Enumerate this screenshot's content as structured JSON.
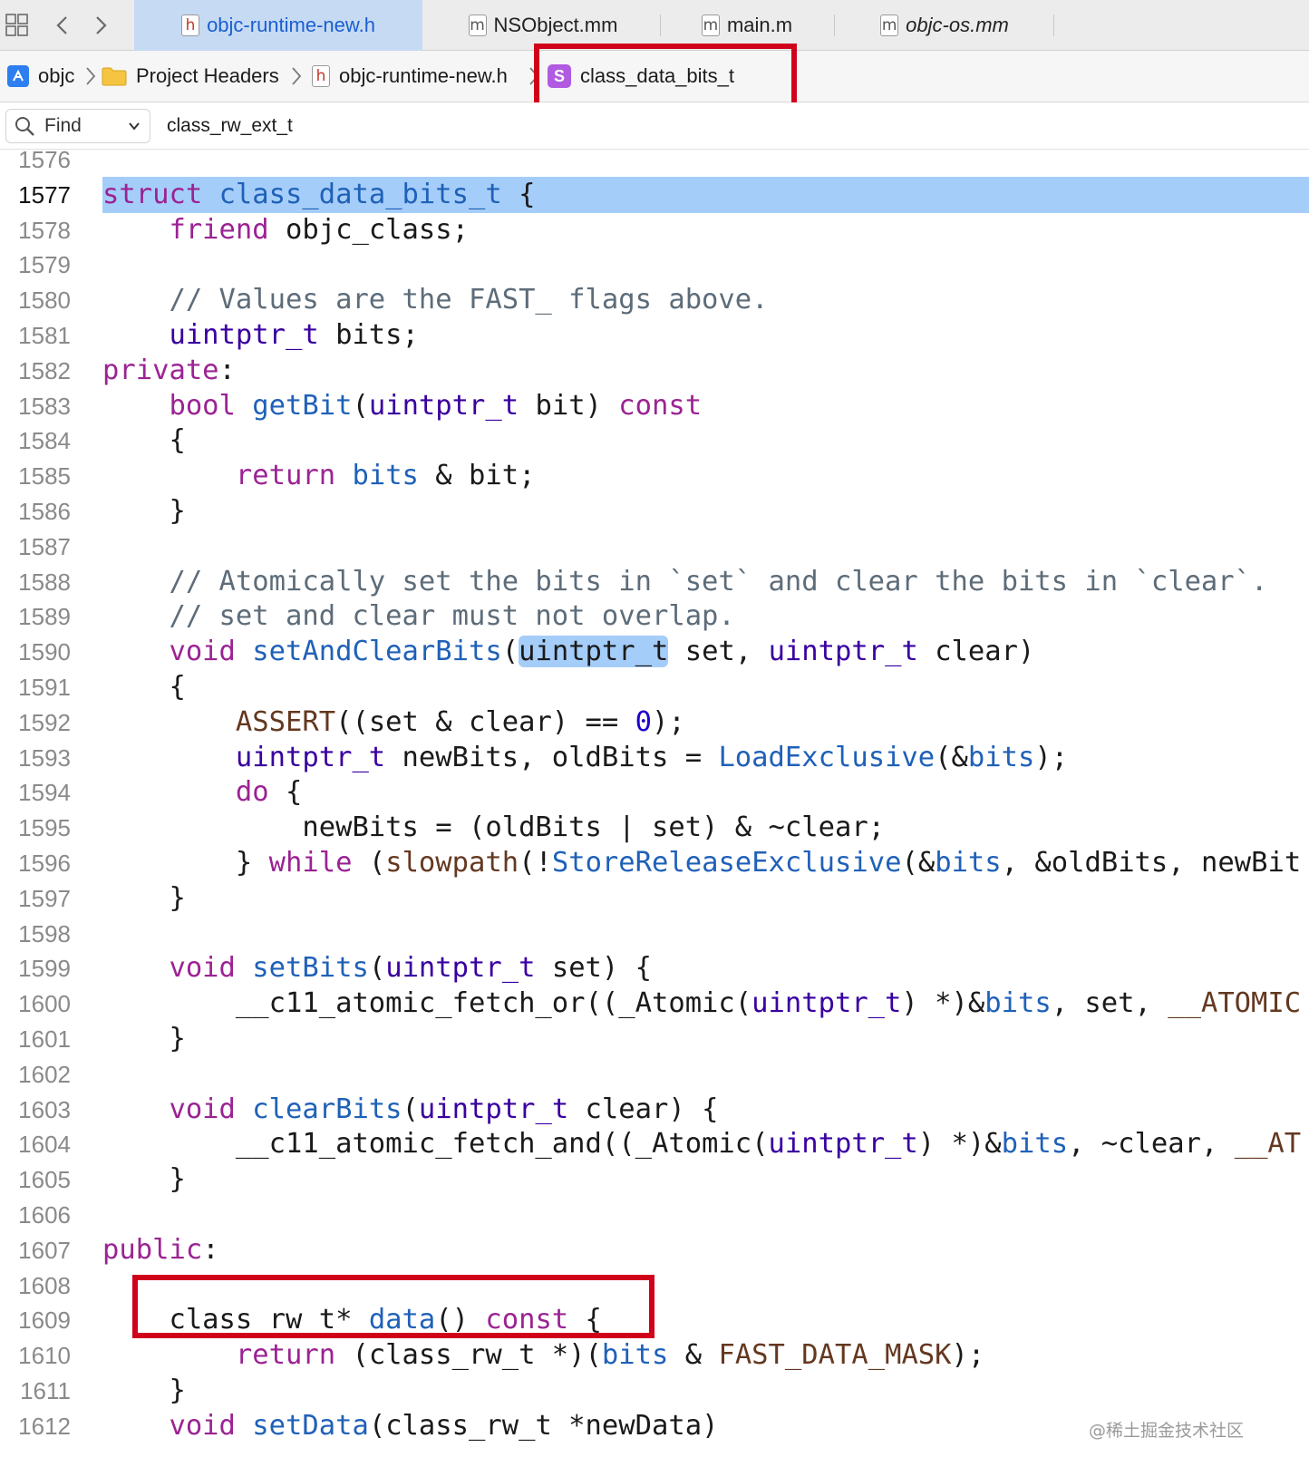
{
  "colors": {
    "active_tab_bg": "#c6daf3",
    "selection": "#a5cdf9",
    "annotation_box": "#d0021b",
    "keyword": "#9b2393",
    "type": "#3900a0",
    "function": "#1f61b8",
    "comment": "#5d6c79",
    "macro": "#643820"
  },
  "toolbar": {
    "grid_icon": "grid-icon",
    "back_icon": "chevron-left-icon",
    "forward_icon": "chevron-right-icon"
  },
  "tabs": [
    {
      "label": "objc-runtime-new.h",
      "icon": "h",
      "active": true
    },
    {
      "label": "NSObject.mm",
      "icon": "m",
      "active": false
    },
    {
      "label": "main.m",
      "icon": "m",
      "active": false
    },
    {
      "label": "objc-os.mm",
      "icon": "m",
      "active": false
    }
  ],
  "jumpbar": [
    {
      "label": "objc",
      "icon": "project-icon"
    },
    {
      "label": "Project Headers",
      "icon": "folder-icon"
    },
    {
      "label": "objc-runtime-new.h",
      "icon": "h"
    },
    {
      "label": "class_data_bits_t",
      "icon": "S"
    }
  ],
  "find": {
    "mode_label": "Find",
    "query": "class_rw_ext_t"
  },
  "editor": {
    "current_line": "1577",
    "lines": [
      {
        "n": "1576",
        "tokens": []
      },
      {
        "n": "1577",
        "tokens": [
          [
            "kw",
            "struct"
          ],
          [
            "t",
            " "
          ],
          [
            "fn",
            "class_data_bits_t"
          ],
          [
            "t",
            " {"
          ]
        ]
      },
      {
        "n": "1578",
        "tokens": [
          [
            "t",
            "    "
          ],
          [
            "kw",
            "friend"
          ],
          [
            "t",
            " objc_class;"
          ]
        ]
      },
      {
        "n": "1579",
        "tokens": []
      },
      {
        "n": "1580",
        "tokens": [
          [
            "t",
            "    "
          ],
          [
            "cm",
            "// Values are the FAST_ flags above."
          ]
        ]
      },
      {
        "n": "1581",
        "tokens": [
          [
            "t",
            "    "
          ],
          [
            "ty",
            "uintptr_t"
          ],
          [
            "t",
            " bits;"
          ]
        ]
      },
      {
        "n": "1582",
        "tokens": [
          [
            "kw",
            "private"
          ],
          [
            "t",
            ":"
          ]
        ]
      },
      {
        "n": "1583",
        "tokens": [
          [
            "t",
            "    "
          ],
          [
            "kw",
            "bool"
          ],
          [
            "t",
            " "
          ],
          [
            "fn",
            "getBit"
          ],
          [
            "t",
            "("
          ],
          [
            "ty",
            "uintptr_t"
          ],
          [
            "t",
            " bit) "
          ],
          [
            "kw",
            "const"
          ]
        ]
      },
      {
        "n": "1584",
        "tokens": [
          [
            "t",
            "    {"
          ]
        ]
      },
      {
        "n": "1585",
        "tokens": [
          [
            "t",
            "        "
          ],
          [
            "kw",
            "return"
          ],
          [
            "t",
            " "
          ],
          [
            "mv",
            "bits"
          ],
          [
            "t",
            " & bit;"
          ]
        ]
      },
      {
        "n": "1586",
        "tokens": [
          [
            "t",
            "    }"
          ]
        ]
      },
      {
        "n": "1587",
        "tokens": []
      },
      {
        "n": "1588",
        "tokens": [
          [
            "t",
            "    "
          ],
          [
            "cm",
            "// Atomically set the bits in `set` and clear the bits in `clear`."
          ]
        ]
      },
      {
        "n": "1589",
        "tokens": [
          [
            "t",
            "    "
          ],
          [
            "cm",
            "// set and clear must not overlap."
          ]
        ]
      },
      {
        "n": "1590",
        "tokens": [
          [
            "t",
            "    "
          ],
          [
            "kw",
            "void"
          ],
          [
            "t",
            " "
          ],
          [
            "fn",
            "setAndClearBits"
          ],
          [
            "t",
            "("
          ],
          [
            "hl",
            "uintptr_t"
          ],
          [
            "t",
            " set, "
          ],
          [
            "ty",
            "uintptr_t"
          ],
          [
            "t",
            " clear)"
          ]
        ]
      },
      {
        "n": "1591",
        "tokens": [
          [
            "t",
            "    {"
          ]
        ]
      },
      {
        "n": "1592",
        "tokens": [
          [
            "t",
            "        "
          ],
          [
            "mac",
            "ASSERT"
          ],
          [
            "t",
            "((set & clear) == "
          ],
          [
            "num",
            "0"
          ],
          [
            "t",
            ");"
          ]
        ]
      },
      {
        "n": "1593",
        "tokens": [
          [
            "t",
            "        "
          ],
          [
            "ty",
            "uintptr_t"
          ],
          [
            "t",
            " newBits, oldBits = "
          ],
          [
            "fn",
            "LoadExclusive"
          ],
          [
            "t",
            "(&"
          ],
          [
            "mv",
            "bits"
          ],
          [
            "t",
            ");"
          ]
        ]
      },
      {
        "n": "1594",
        "tokens": [
          [
            "t",
            "        "
          ],
          [
            "kw",
            "do"
          ],
          [
            "t",
            " {"
          ]
        ]
      },
      {
        "n": "1595",
        "tokens": [
          [
            "t",
            "            newBits = (oldBits | set) & ~clear;"
          ]
        ]
      },
      {
        "n": "1596",
        "tokens": [
          [
            "t",
            "        } "
          ],
          [
            "kw",
            "while"
          ],
          [
            "t",
            " ("
          ],
          [
            "mac",
            "slowpath"
          ],
          [
            "t",
            "(!"
          ],
          [
            "fn",
            "StoreReleaseExclusive"
          ],
          [
            "t",
            "(&"
          ],
          [
            "mv",
            "bits"
          ],
          [
            "t",
            ", &oldBits, newBit"
          ]
        ]
      },
      {
        "n": "1597",
        "tokens": [
          [
            "t",
            "    }"
          ]
        ]
      },
      {
        "n": "1598",
        "tokens": []
      },
      {
        "n": "1599",
        "tokens": [
          [
            "t",
            "    "
          ],
          [
            "kw",
            "void"
          ],
          [
            "t",
            " "
          ],
          [
            "fn",
            "setBits"
          ],
          [
            "t",
            "("
          ],
          [
            "ty",
            "uintptr_t"
          ],
          [
            "t",
            " set) {"
          ]
        ]
      },
      {
        "n": "1600",
        "tokens": [
          [
            "t",
            "        __c11_atomic_fetch_or((_Atomic("
          ],
          [
            "ty",
            "uintptr_t"
          ],
          [
            "t",
            ") *)&"
          ],
          [
            "mv",
            "bits"
          ],
          [
            "t",
            ", set, "
          ],
          [
            "mac",
            "__ATOMIC"
          ]
        ]
      },
      {
        "n": "1601",
        "tokens": [
          [
            "t",
            "    }"
          ]
        ]
      },
      {
        "n": "1602",
        "tokens": []
      },
      {
        "n": "1603",
        "tokens": [
          [
            "t",
            "    "
          ],
          [
            "kw",
            "void"
          ],
          [
            "t",
            " "
          ],
          [
            "fn",
            "clearBits"
          ],
          [
            "t",
            "("
          ],
          [
            "ty",
            "uintptr_t"
          ],
          [
            "t",
            " clear) {"
          ]
        ]
      },
      {
        "n": "1604",
        "tokens": [
          [
            "t",
            "        __c11_atomic_fetch_and((_Atomic("
          ],
          [
            "ty",
            "uintptr_t"
          ],
          [
            "t",
            ") *)&"
          ],
          [
            "mv",
            "bits"
          ],
          [
            "t",
            ", ~clear, "
          ],
          [
            "mac",
            "__AT"
          ]
        ]
      },
      {
        "n": "1605",
        "tokens": [
          [
            "t",
            "    }"
          ]
        ]
      },
      {
        "n": "1606",
        "tokens": []
      },
      {
        "n": "1607",
        "tokens": [
          [
            "kw",
            "public"
          ],
          [
            "t",
            ":"
          ]
        ]
      },
      {
        "n": "1608",
        "tokens": []
      },
      {
        "n": "1609",
        "tokens": [
          [
            "t",
            "    class_rw_t* "
          ],
          [
            "fn",
            "data"
          ],
          [
            "t",
            "() "
          ],
          [
            "kw",
            "const"
          ],
          [
            "t",
            " {"
          ]
        ]
      },
      {
        "n": "1610",
        "tokens": [
          [
            "t",
            "        "
          ],
          [
            "kw",
            "return"
          ],
          [
            "t",
            " (class_rw_t *)("
          ],
          [
            "mv",
            "bits"
          ],
          [
            "t",
            " & "
          ],
          [
            "mac",
            "FAST_DATA_MASK"
          ],
          [
            "t",
            ");"
          ]
        ]
      },
      {
        "n": "1611",
        "tokens": [
          [
            "t",
            "    }"
          ]
        ]
      },
      {
        "n": "1612",
        "tokens": [
          [
            "t",
            "    "
          ],
          [
            "kw",
            "void"
          ],
          [
            "t",
            " "
          ],
          [
            "fn",
            "setData"
          ],
          [
            "t",
            "(class_rw_t *newData)"
          ]
        ]
      }
    ]
  },
  "watermark": "@稀土掘金技术社区"
}
